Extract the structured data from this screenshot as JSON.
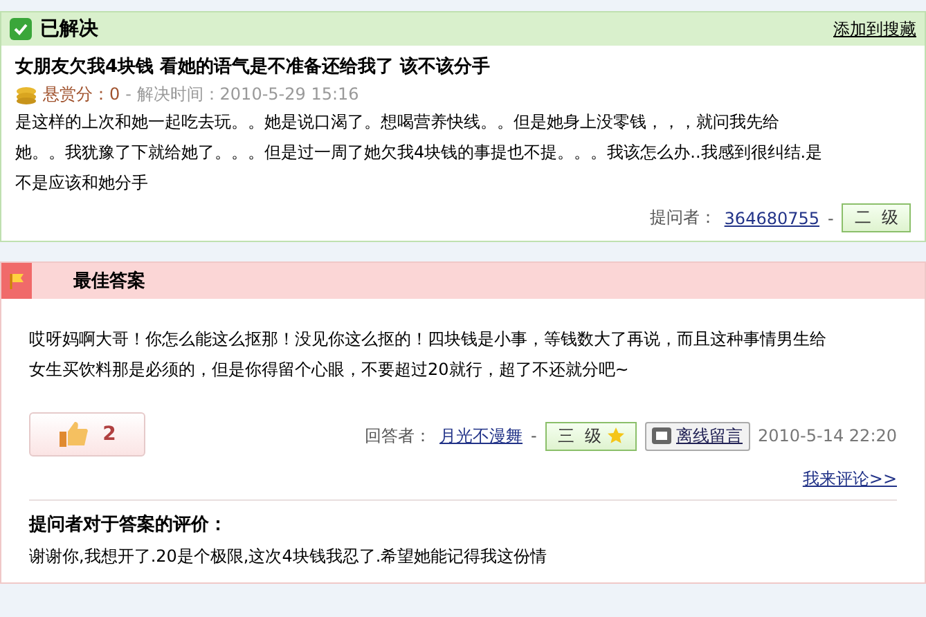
{
  "question": {
    "status": "已解决",
    "status_checked": true,
    "add_favorite": "添加到搜藏",
    "title": "女朋友欠我4块钱  看她的语气是不准备还给我了  该不该分手",
    "reward_label": "悬赏分：0",
    "solved_time": "- 解决时间：2010-5-29 15:16",
    "body": "是这样的上次和她一起吃去玩。。她是说口渴了。想喝营养快线。。但是她身上没零钱，，，就问我先给她。。我犹豫了下就给她了。。。但是过一周了她欠我4块钱的事提也不提。。。我该怎么办..我感到很纠结.是不是应该和她分手",
    "asker_label": "提问者：",
    "asker": "364680755",
    "dash": "-",
    "level": "二  级"
  },
  "answer": {
    "header": "最佳答案",
    "body": "哎呀妈啊大哥！你怎么能这么抠那！没见你这么抠的！四块钱是小事，等钱数大了再说，而且这种事情男生给女生买饮料那是必须的，但是你得留个心眼，不要超过20就行，超了不还就分吧~",
    "likes": "2",
    "answerer_label": "回答者：",
    "answerer": "月光不漫舞",
    "dash": "-",
    "level": "三  级",
    "message": "离线留言",
    "date": "2010-5-14 22:20",
    "comment": "我来评论>>"
  },
  "evaluation": {
    "title": "提问者对于答案的评价：",
    "text": "谢谢你,我想开了.20是个极限,这次4块钱我忍了.希望她能记得我这份情"
  }
}
